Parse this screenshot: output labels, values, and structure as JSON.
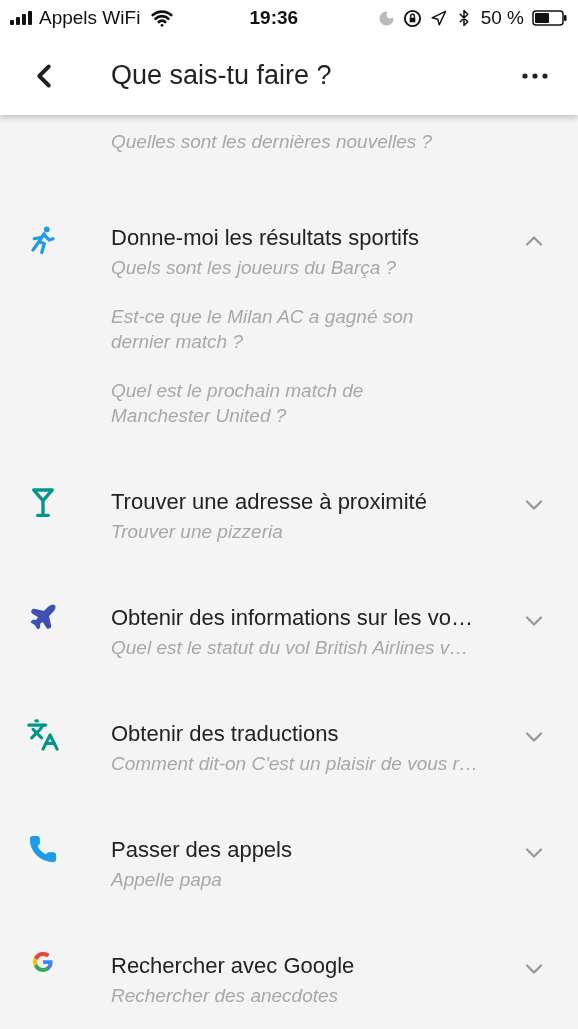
{
  "status_bar": {
    "carrier": "Appels WiFi",
    "time": "19:36",
    "battery": "50 %"
  },
  "header": {
    "title": "Que sais-tu faire ?"
  },
  "items": [
    {
      "kind": "news",
      "examples": [
        "Quelles sont les dernières nouvelles ?"
      ]
    },
    {
      "kind": "sports",
      "title": "Donne-moi les résultats sportifs",
      "examples": [
        "Quels sont les joueurs du Barça ?",
        "Est-ce que le Milan AC a gagné son dernier match ?",
        "Quel est le prochain match de Manchester United ?"
      ],
      "expanded": true
    },
    {
      "kind": "cocktail",
      "title": "Trouver une adresse à proximité",
      "examples": [
        "Trouver une pizzeria"
      ],
      "expanded": false
    },
    {
      "kind": "plane",
      "title": "Obtenir des informations sur les vo…",
      "examples": [
        "Quel est le statut du vol British Airlines v…"
      ],
      "expanded": false
    },
    {
      "kind": "translate",
      "title": "Obtenir des traductions",
      "examples": [
        "Comment dit-on C'est un plaisir de vous r…"
      ],
      "expanded": false
    },
    {
      "kind": "phone",
      "title": "Passer des appels",
      "examples": [
        "Appelle papa"
      ],
      "expanded": false
    },
    {
      "kind": "google",
      "title": "Rechercher avec Google",
      "examples": [
        "Rechercher des anecdotes"
      ],
      "expanded": false
    }
  ]
}
